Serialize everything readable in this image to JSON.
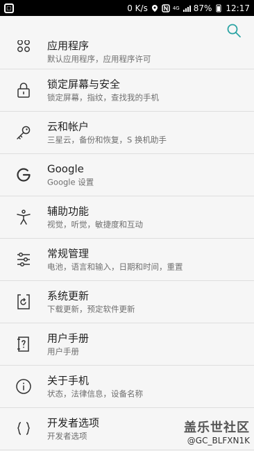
{
  "status_bar": {
    "speed": "0 K/s",
    "network": "4G",
    "battery": "87%",
    "time": "12:17"
  },
  "header": {
    "search_icon": "search-icon"
  },
  "items": [
    {
      "icon": "grid-icon",
      "title": "应用程序",
      "subtitle": "默认应用程序，应用程序许可"
    },
    {
      "icon": "lock-icon",
      "title": "锁定屏幕与安全",
      "subtitle": "锁定屏幕，指纹，查找我的手机"
    },
    {
      "icon": "key-icon",
      "title": "云和帐户",
      "subtitle": "三星云，备份和恢复，S 换机助手"
    },
    {
      "icon": "google-icon",
      "title": "Google",
      "subtitle": "Google 设置"
    },
    {
      "icon": "accessibility-icon",
      "title": "辅助功能",
      "subtitle": "视觉，听觉，敏捷度和互动"
    },
    {
      "icon": "sliders-icon",
      "title": "常规管理",
      "subtitle": "电池，语言和输入，日期和时间，重置"
    },
    {
      "icon": "system-update-icon",
      "title": "系统更新",
      "subtitle": "下载更新，预定软件更新"
    },
    {
      "icon": "manual-icon",
      "title": "用户手册",
      "subtitle": "用户手册"
    },
    {
      "icon": "info-icon",
      "title": "关于手机",
      "subtitle": "状态，法律信息，设备名称"
    },
    {
      "icon": "braces-icon",
      "title": "开发者选项",
      "subtitle": "开发者选项"
    }
  ],
  "watermark": {
    "line1": "盖乐世社区",
    "line2": "@GC_BLFXN1K"
  },
  "colors": {
    "background": "#f6f6f6",
    "accent": "#2aa3a3",
    "divider": "#dedede"
  }
}
